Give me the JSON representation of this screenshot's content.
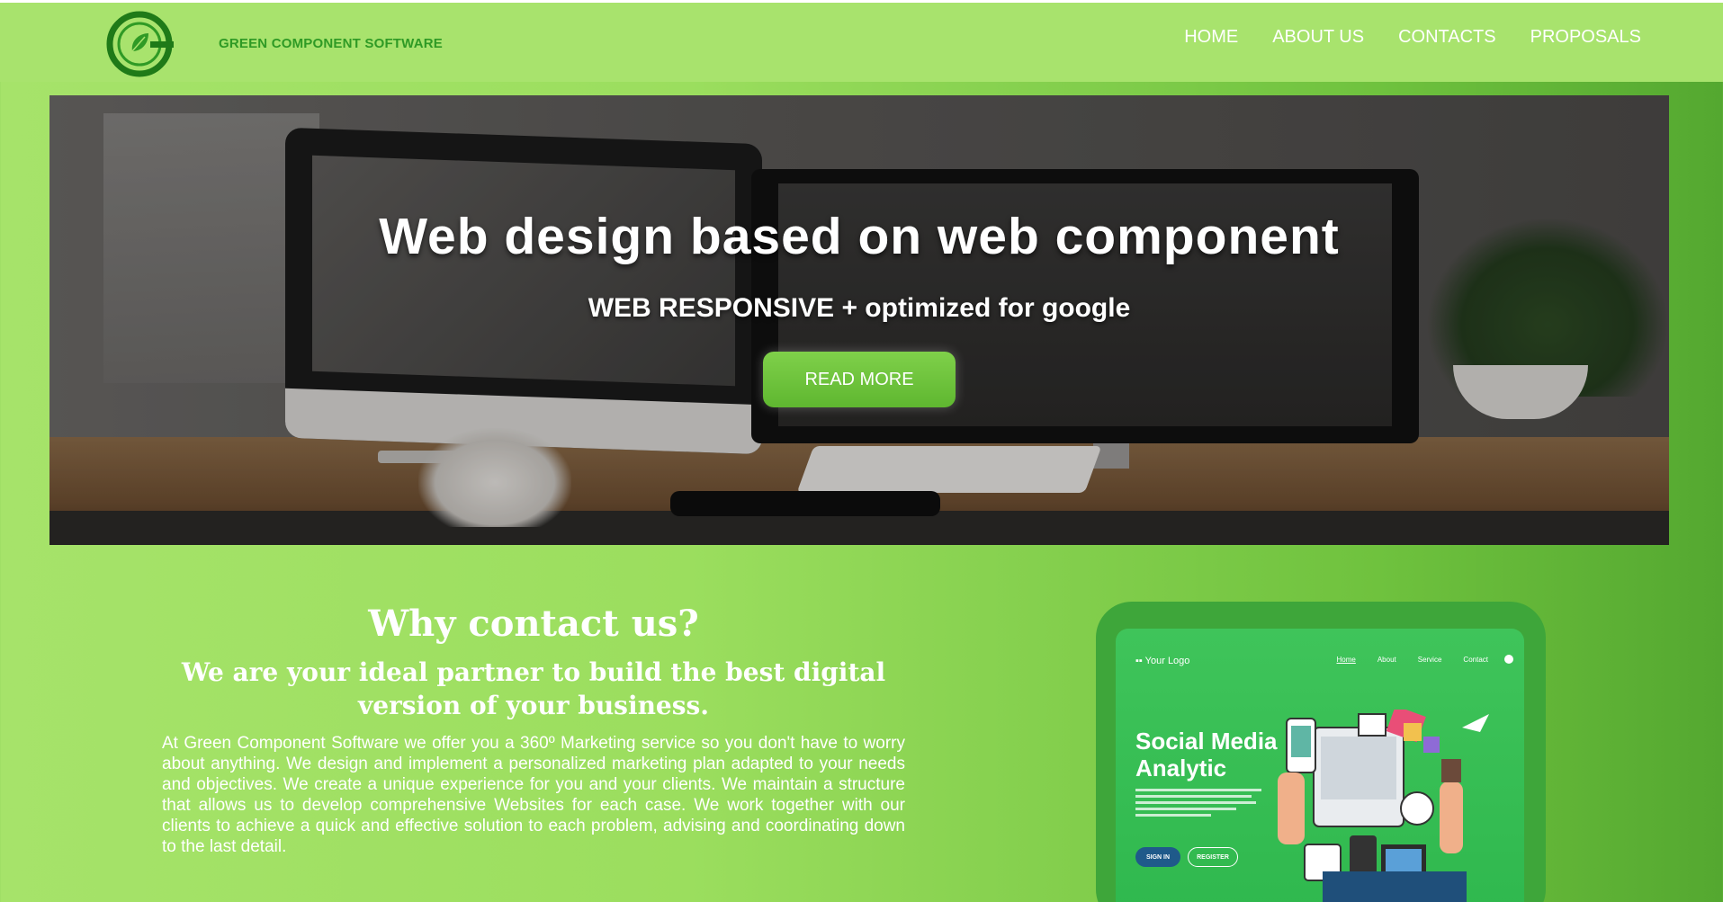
{
  "header": {
    "brand": "GREEN COMPONENT SOFTWARE",
    "nav": [
      "HOME",
      "ABOUT US",
      "CONTACTS",
      "PROPOSALS"
    ]
  },
  "hero": {
    "title": "Web design based on web component",
    "subtitle": "WEB RESPONSIVE + optimized for google",
    "cta": "READ MORE"
  },
  "about": {
    "heading": "Why contact us?",
    "subheading": "We are your ideal partner to build the best digital version of your business.",
    "body": "At Green Component Software we offer you a 360º Marketing service so you don't have to worry about anything. We design and implement a personalized marketing plan adapted to your needs and objectives. We create a unique experience for you and your clients. We maintain a structure that allows us to develop comprehensive Websites for each case. We work together with our clients to achieve a quick and effective solution to each problem, advising and coordinating down to the last detail."
  },
  "mockup": {
    "logo": "▪▪ Your Logo",
    "nav": [
      "Home",
      "About",
      "Service",
      "Contact"
    ],
    "title_line1": "Social Media",
    "title_line2": "Analytic",
    "signin": "SIGN IN",
    "register": "REGISTER"
  },
  "colors": {
    "background": "#9bde5e",
    "navbar": "#a8e36d",
    "brand_text": "#2f9a25",
    "button": "#6cc43c",
    "mockup_frame": "#3ea63a"
  }
}
